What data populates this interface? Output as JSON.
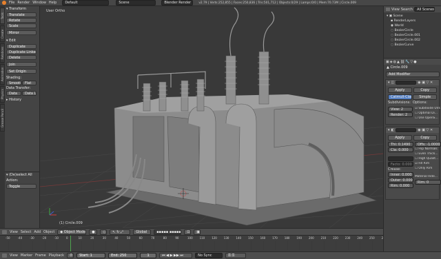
{
  "topbar": {
    "menus": [
      "File",
      "Render",
      "Window",
      "Help"
    ],
    "layout": "Default",
    "scene": "Scene",
    "engine": "Blender Render",
    "stats": "v2.79 | Verts:252,855 | Faces:250,836 | Tris:501,712 | Objects:0/29 | Lamps:0/0 | Mem:70.73M | Circle.009"
  },
  "toolshelf": {
    "vtabs": [
      "Tools",
      "Create",
      "Relations",
      "Animation",
      "Physics",
      "Grease Pencil"
    ],
    "transform_header": "Transform",
    "transform": [
      "Translate",
      "Rotate",
      "Scale",
      "Mirror"
    ],
    "edit_header": "Edit",
    "edit": [
      "Duplicate",
      "Duplicate Linked",
      "Delete",
      "Join"
    ],
    "set_origin": "Set Origin",
    "shading_header": "Shading:",
    "smooth": "Smooth",
    "flat": "Flat",
    "data_transfer_header": "Data Transfer:",
    "data": "Data",
    "data_layout": "Data Layo",
    "history_header": "History",
    "last_op": "(De)select All",
    "action_label": "Action:",
    "action_value": "Toggle"
  },
  "viewport": {
    "label": "User Ortho",
    "object": "(1) Circle.009"
  },
  "viewport_header": {
    "items": [
      "View",
      "Select",
      "Add",
      "Object"
    ],
    "mode": "Object Mode",
    "pivot": "Global"
  },
  "outliner": {
    "tabs": [
      "View",
      "Search",
      "All Scenes"
    ],
    "items": [
      {
        "label": "Scene",
        "sel": false
      },
      {
        "label": "RenderLayers",
        "sel": false
      },
      {
        "label": "World",
        "sel": false
      },
      {
        "label": "BezierCircle",
        "sel": false
      },
      {
        "label": "BezierCircle.001",
        "sel": false
      },
      {
        "label": "BezierCircle.002",
        "sel": false
      },
      {
        "label": "BezierCurve",
        "sel": false
      }
    ]
  },
  "properties": {
    "object": "Circle.009",
    "add_modifier": "Add Modifier",
    "mod1": {
      "apply": "Apply",
      "copy": "Copy",
      "catmull": "Catmull-Clark",
      "simple": "Simple",
      "subdivisions": "Subdivisions:",
      "options": "Options:",
      "view": "View:",
      "view_val": "2",
      "render": "Render:",
      "render_val": "2",
      "subdivide_uvs": "Subdivide UVs",
      "optimal_display": "Optimal Di...",
      "use_opensubdiv": "Use OpenS..."
    },
    "mod2": {
      "apply": "Apply",
      "copy": "Copy",
      "thickness": "Thi: 0.1490",
      "offset": "Offs: -1.0000",
      "clamp": "Cla: 0.000",
      "flip_normals": "Flip Normals",
      "even_thickness": "Even Thick...",
      "factor": "Facto: 0.000",
      "high_quality": "High Qualit...",
      "fill_rim": "Fill Rim",
      "only_rim": "Only Rim",
      "crease": "Crease:",
      "inner": "Inner: 0.000",
      "outer": "Outer: 0.000",
      "material_index": "Material Inde...",
      "rim": "Rim: 0.000",
      "rim2": "Rim: 0"
    }
  },
  "timeline": {
    "ticks": [
      "-50",
      "-40",
      "-30",
      "-20",
      "-10",
      "0",
      "10",
      "20",
      "30",
      "40",
      "50",
      "60",
      "70",
      "80",
      "90",
      "100",
      "110",
      "120",
      "130",
      "140",
      "150",
      "160",
      "170",
      "180",
      "190",
      "200",
      "210",
      "220",
      "230",
      "240",
      "250",
      "260"
    ],
    "menus": [
      "View",
      "Marker",
      "Frame",
      "Playback"
    ],
    "start": "Start:",
    "start_val": "1",
    "end": "End:",
    "end_val": "250",
    "current": "1",
    "sync": "No Sync"
  }
}
